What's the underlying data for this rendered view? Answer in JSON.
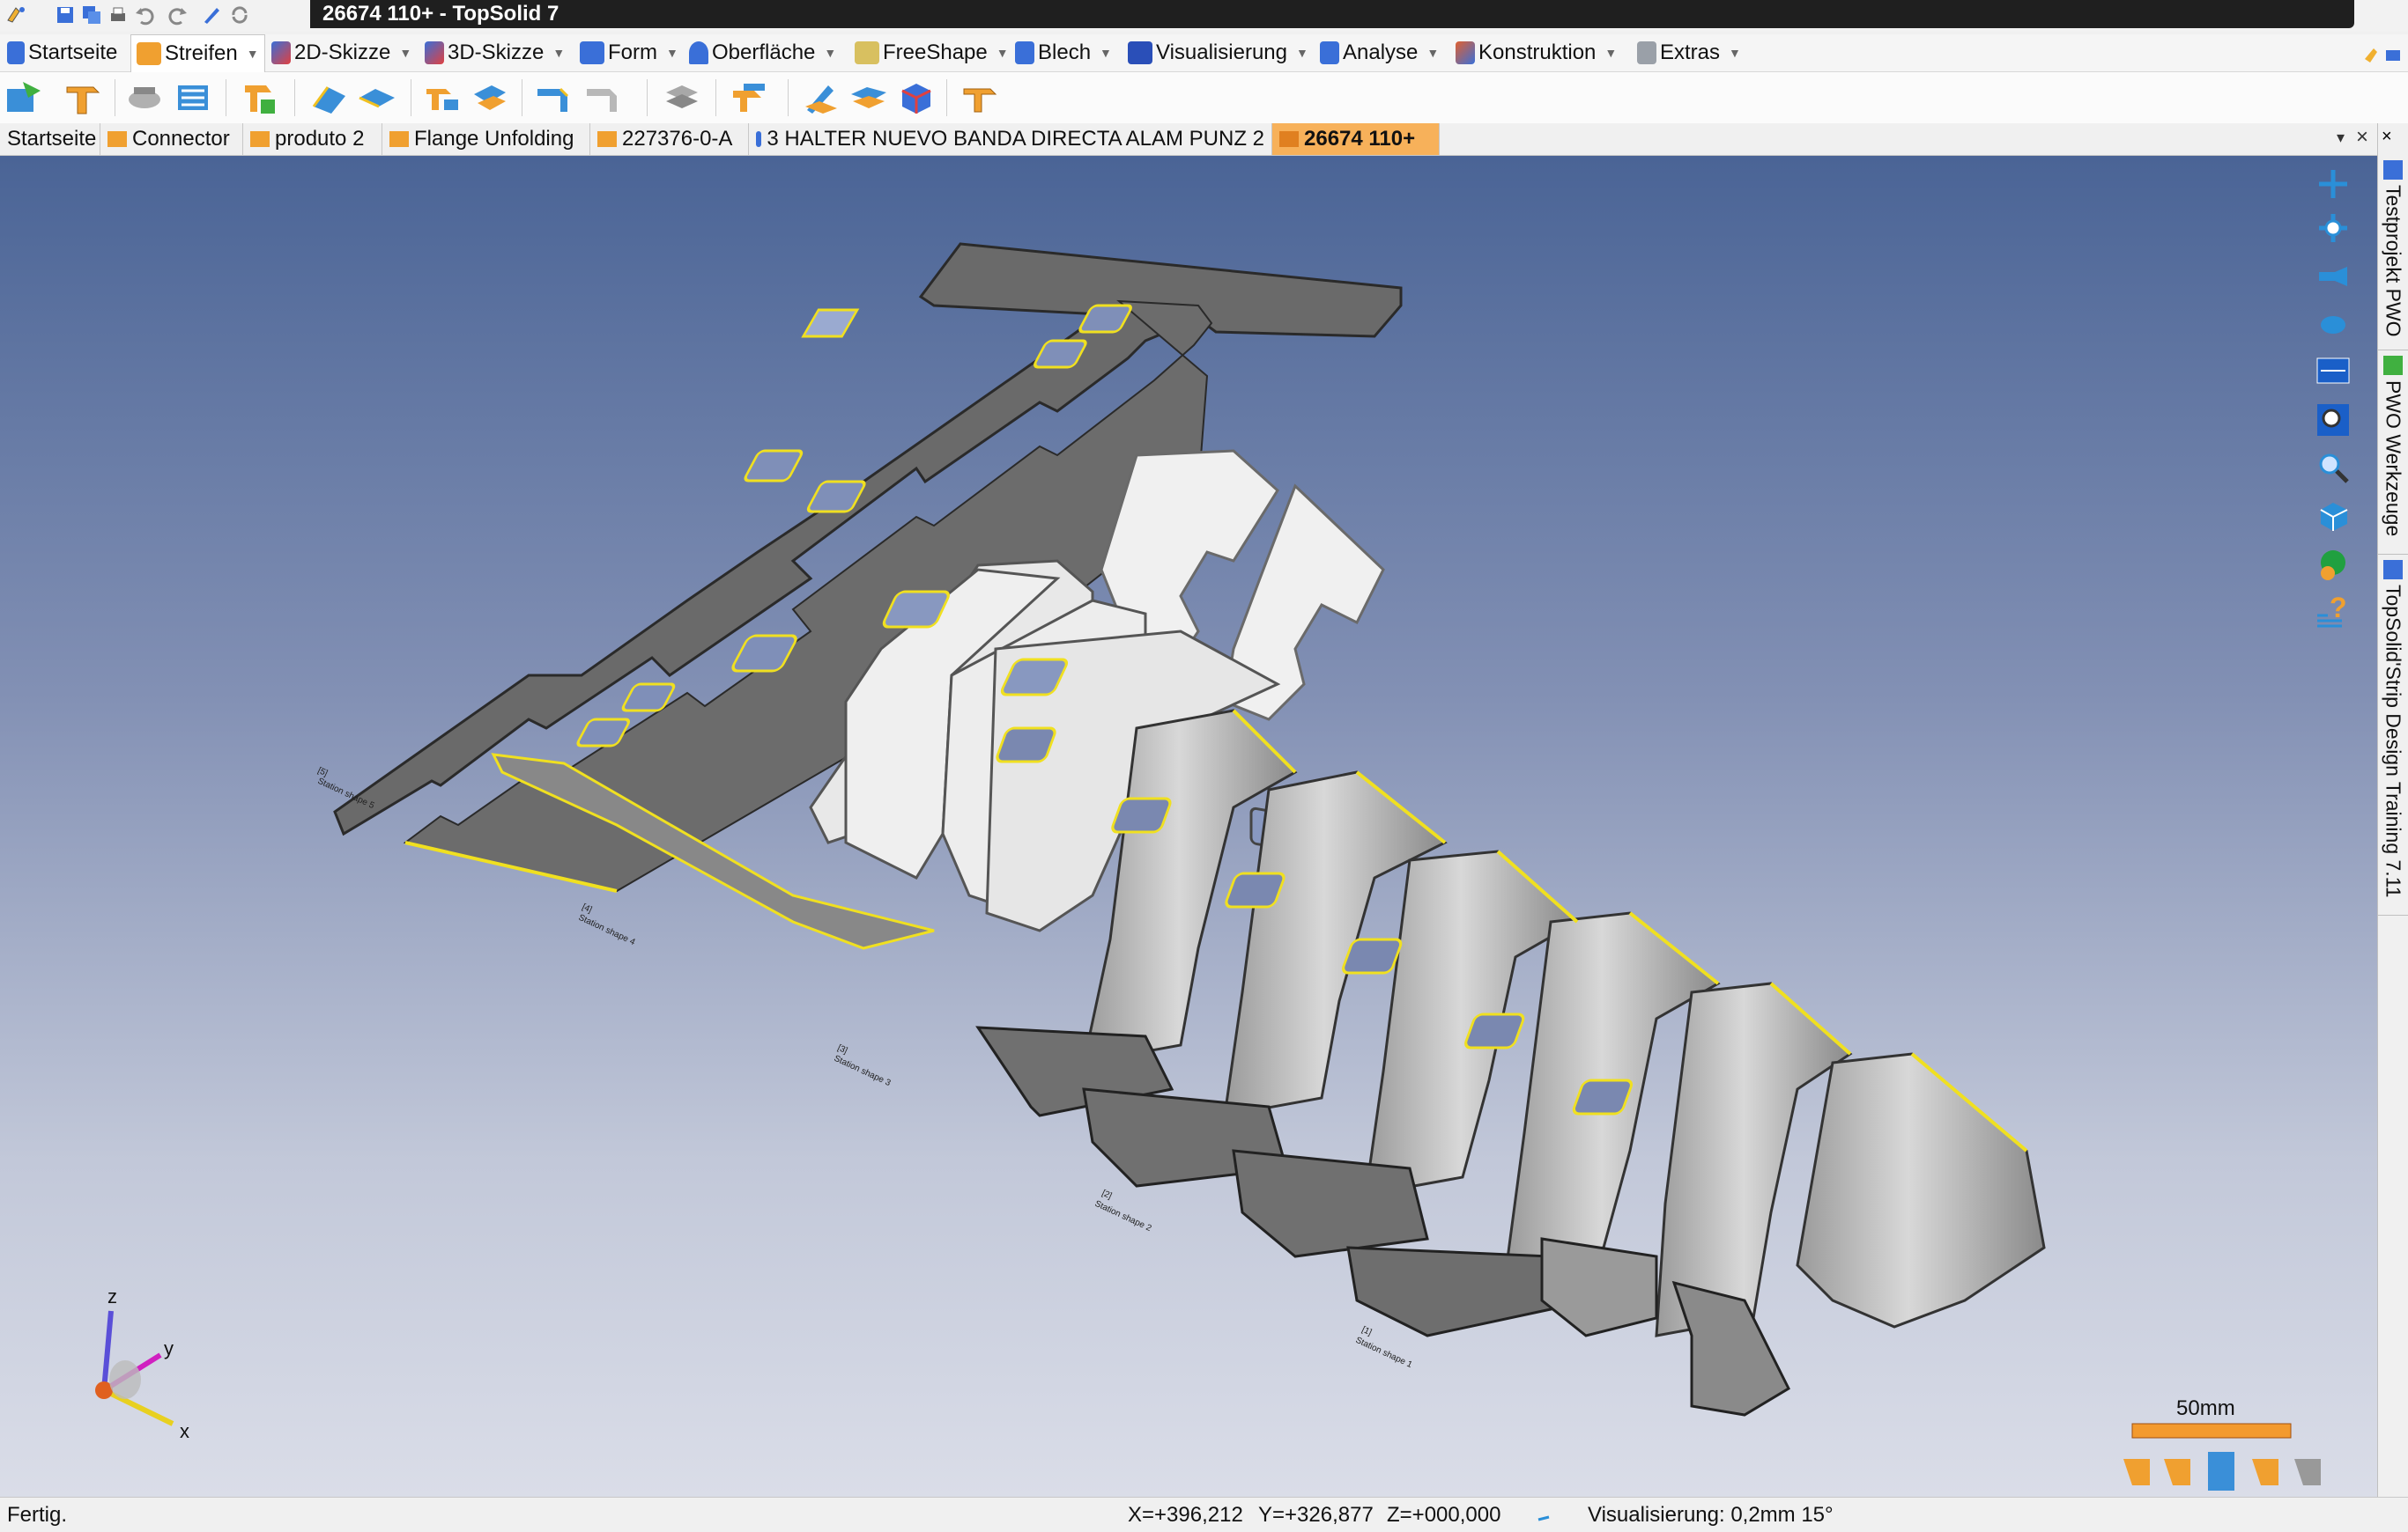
{
  "window": {
    "title": "26674 110+ - TopSolid 7"
  },
  "menu": {
    "items": [
      {
        "label": "Startseite"
      },
      {
        "label": "Streifen"
      },
      {
        "label": "2D-Skizze"
      },
      {
        "label": "3D-Skizze"
      },
      {
        "label": "Form"
      },
      {
        "label": "Oberfläche"
      },
      {
        "label": "FreeShape"
      },
      {
        "label": "Blech"
      },
      {
        "label": "Visualisierung"
      },
      {
        "label": "Analyse"
      },
      {
        "label": "Konstruktion"
      },
      {
        "label": "Extras"
      }
    ],
    "active": "Streifen"
  },
  "doc_tabs": [
    {
      "label": "Startseite"
    },
    {
      "label": "Connector"
    },
    {
      "label": "produto 2"
    },
    {
      "label": "Flange Unfolding"
    },
    {
      "label": "227376-0-A"
    },
    {
      "label": "3 HALTER NUEVO BANDA DIRECTA ALAM PUNZ 2"
    },
    {
      "label": "26674 110+"
    }
  ],
  "dock_tabs": [
    {
      "label": "Testprojekt PWO"
    },
    {
      "label": "PWO Werkzeuge"
    },
    {
      "label": "TopSolid'Strip Design Training 7.11"
    }
  ],
  "viewport": {
    "axes": {
      "x": "x",
      "y": "y",
      "z": "z"
    },
    "scale_label": "50mm",
    "stage_labels": [
      "Station shape 5",
      "Station shape 4",
      "Station shape 3",
      "Station shape 2",
      "Station shape 1"
    ],
    "stage_numbers": [
      "[5]",
      "[4]",
      "[3]",
      "[2]",
      "[1]"
    ]
  },
  "status": {
    "message": "Fertig.",
    "x": "X=+396,212",
    "y": "Y=+326,877",
    "z": "Z=+000,000",
    "visualization": "Visualisierung: 0,2mm 15°"
  },
  "colors": {
    "title_bg": "#1f1f1f",
    "active_tab": "#f7b15a",
    "edge_yellow": "#f0e020",
    "scale_bar": "#f39a2e",
    "viewport_top": "#4a6496",
    "viewport_bottom": "#dadde8"
  }
}
